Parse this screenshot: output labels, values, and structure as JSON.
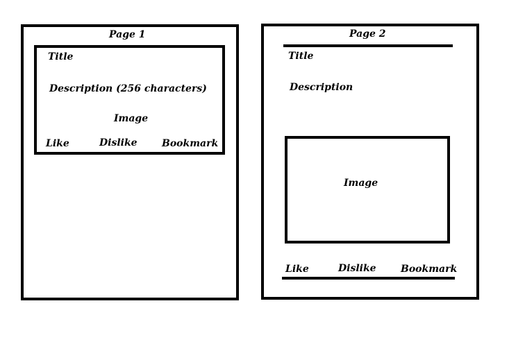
{
  "page1": {
    "title": "Page 1",
    "card": {
      "title_label": "Title",
      "description_label": "Description (256 characters)",
      "image_label": "Image",
      "like_label": "Like",
      "dislike_label": "Dislike",
      "bookmark_label": "Bookmark"
    }
  },
  "page2": {
    "title": "Page 2",
    "title_label": "Title",
    "description_label": "Description",
    "image_label": "Image",
    "like_label": "Like",
    "dislike_label": "Dislike",
    "bookmark_label": "Bookmark"
  },
  "colors": {
    "stroke": "#000000",
    "background": "#ffffff"
  }
}
